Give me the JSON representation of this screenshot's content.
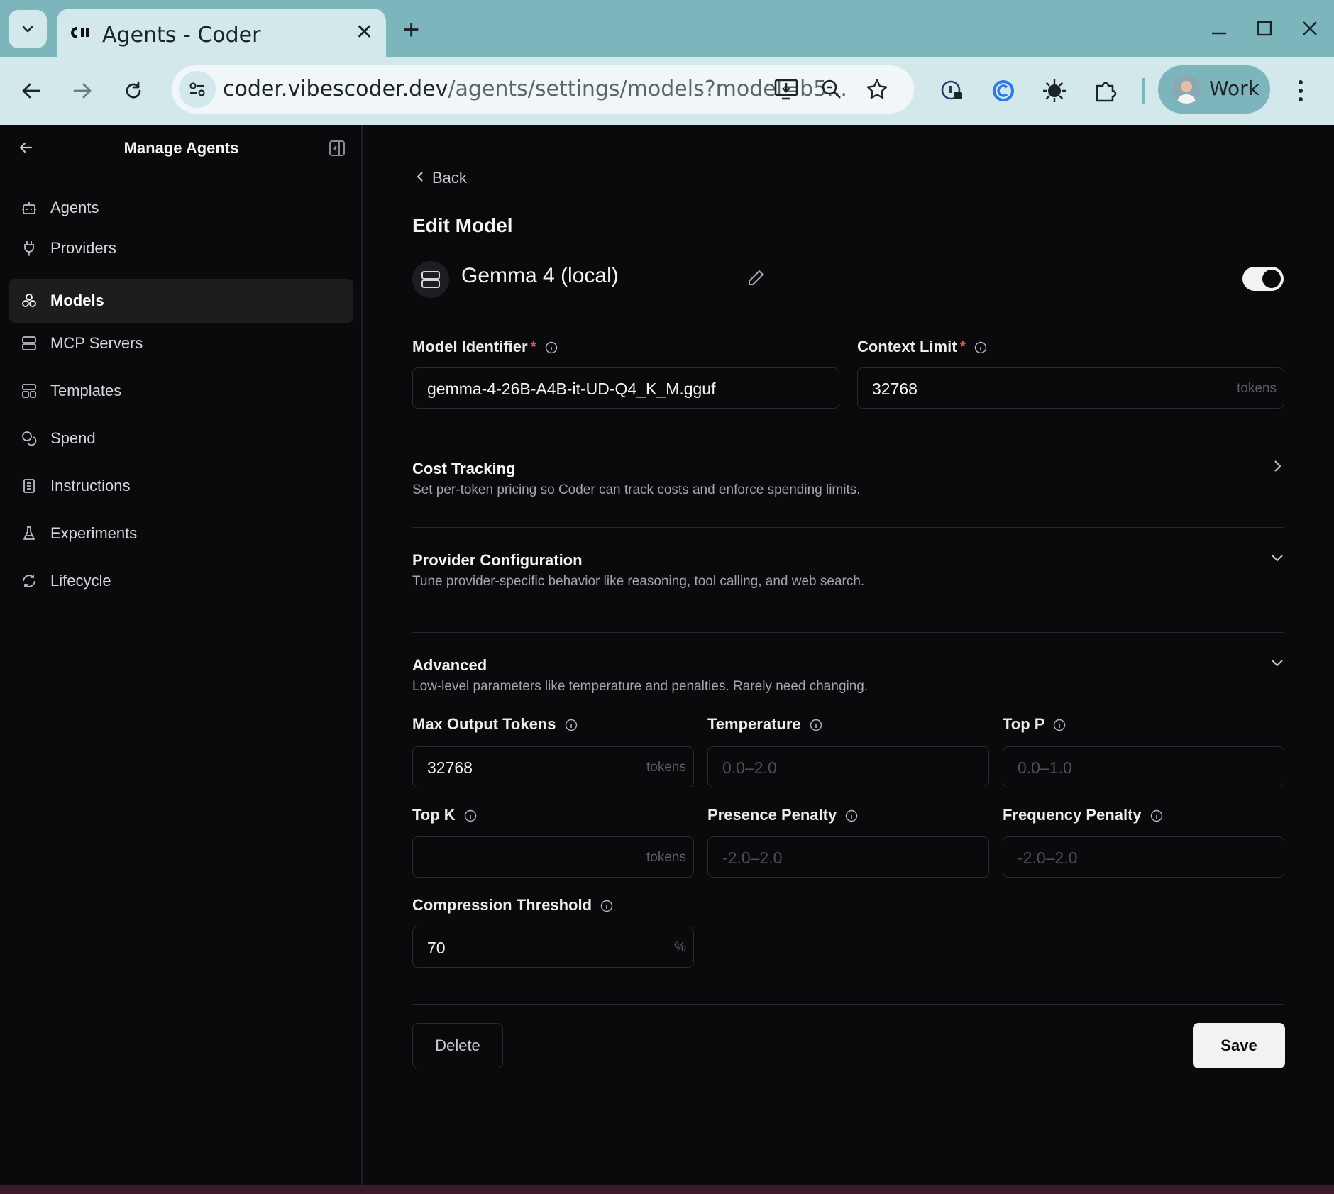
{
  "browser": {
    "tab_title": "Agents - Coder",
    "url_host": "coder.vibescoder.dev",
    "url_path": "/agents/settings/models?model=b5...",
    "profile_label": "Work"
  },
  "sidebar": {
    "title": "Manage Agents",
    "items": [
      {
        "label": "Agents",
        "icon": "bot-icon"
      },
      {
        "label": "Providers",
        "icon": "plug-icon"
      },
      {
        "label": "Models",
        "icon": "boxes-icon"
      },
      {
        "label": "MCP Servers",
        "icon": "server-icon"
      },
      {
        "label": "Templates",
        "icon": "layout-icon"
      },
      {
        "label": "Spend",
        "icon": "coins-icon"
      },
      {
        "label": "Instructions",
        "icon": "file-text-icon"
      },
      {
        "label": "Experiments",
        "icon": "flask-icon"
      },
      {
        "label": "Lifecycle",
        "icon": "refresh-icon"
      }
    ],
    "active": "Models"
  },
  "main": {
    "back_label": "Back",
    "page_title": "Edit Model",
    "model_name": "Gemma 4 (local)",
    "enabled": true,
    "model_identifier": {
      "label": "Model Identifier",
      "required": "*",
      "value": "gemma-4-26B-A4B-it-UD-Q4_K_M.gguf"
    },
    "context_limit": {
      "label": "Context Limit",
      "required": "*",
      "value": "32768",
      "suffix": "tokens"
    },
    "cost_tracking": {
      "title": "Cost Tracking",
      "desc": "Set per-token pricing so Coder can track costs and enforce spending limits."
    },
    "provider_config": {
      "title": "Provider Configuration",
      "desc": "Tune provider-specific behavior like reasoning, tool calling, and web search."
    },
    "advanced": {
      "title": "Advanced",
      "desc": "Low-level parameters like temperature and penalties. Rarely need changing.",
      "max_output_tokens": {
        "label": "Max Output Tokens",
        "value": "32768",
        "suffix": "tokens"
      },
      "temperature": {
        "label": "Temperature",
        "placeholder": "0.0–2.0"
      },
      "top_p": {
        "label": "Top P",
        "placeholder": "0.0–1.0"
      },
      "top_k": {
        "label": "Top K",
        "suffix": "tokens"
      },
      "presence_penalty": {
        "label": "Presence Penalty",
        "placeholder": "-2.0–2.0"
      },
      "frequency_penalty": {
        "label": "Frequency Penalty",
        "placeholder": "-2.0–2.0"
      },
      "compression_threshold": {
        "label": "Compression Threshold",
        "value": "70",
        "suffix": "%"
      }
    },
    "delete_label": "Delete",
    "save_label": "Save"
  }
}
